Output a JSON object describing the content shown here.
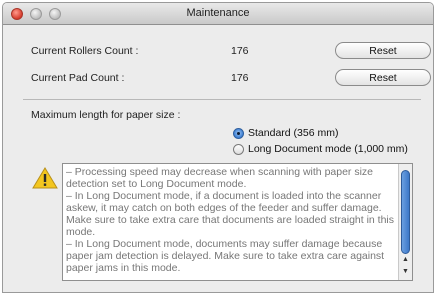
{
  "window": {
    "title": "Maintenance"
  },
  "counts": {
    "rollers_label": "Current Rollers Count :",
    "rollers_value": "176",
    "pad_label": "Current Pad Count :",
    "pad_value": "176",
    "reset_label": "Reset"
  },
  "paper": {
    "heading": "Maximum length for paper size :",
    "options": [
      {
        "label": "Standard (356 mm)",
        "selected": true
      },
      {
        "label": "Long Document mode (1,000 mm)",
        "selected": false
      }
    ]
  },
  "notes": {
    "text": "– Processing speed may decrease when scanning with paper size detection set to Long Document mode.\n– In Long Document mode, if a document is loaded into the scanner askew, it may catch on both edges of the feeder and suffer damage. Make sure to take extra care that documents are loaded straight in this mode.\n– In Long Document mode, documents may suffer damage because paper jam detection is delayed. Make sure to take extra care against paper jams in this mode."
  },
  "icons": {
    "warning": "warning-icon",
    "scroll_up": "chevron-up-icon",
    "scroll_down": "chevron-down-icon"
  },
  "colors": {
    "accent": "#3b7fd4",
    "warning": "#f3c61f"
  }
}
